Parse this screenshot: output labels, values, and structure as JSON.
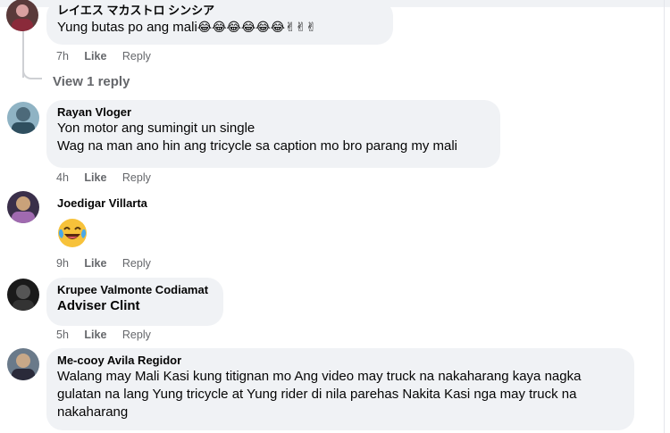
{
  "comments": [
    {
      "author": "レイエス マカストロ シンシア",
      "text": "Yung butas po ang mali",
      "emojis": "😂😂😂😂😂😂✌✌✌",
      "time": "7h",
      "like": "Like",
      "reply": "Reply",
      "view_replies": "View 1 reply"
    },
    {
      "author": "Rayan Vloger",
      "lines": [
        "Yon motor ang sumingit un single",
        "Wag na man ano hin ang tricycle sa caption mo bro parang my mali"
      ],
      "time": "4h",
      "like": "Like",
      "reply": "Reply"
    },
    {
      "author": "Joedigar Villarta",
      "emoji": "laughing-tears-emoji",
      "time": "9h",
      "like": "Like",
      "reply": "Reply"
    },
    {
      "author": "Krupee Valmonte Codiamat",
      "text": "Adviser Clint",
      "time": "5h",
      "like": "Like",
      "reply": "Reply"
    },
    {
      "author": "Me-cooy Avila Regidor",
      "lines": [
        "Walang may Mali Kasi kung titignan mo Ang video may truck na nakaharang kaya nagka",
        "gulatan na lang Yung tricycle at Yung rider di nila parehas Nakita Kasi nga may truck na",
        "nakaharang"
      ]
    }
  ],
  "colors": {
    "bubble": "#f0f2f5",
    "meta": "#65676b",
    "text": "#050505"
  }
}
